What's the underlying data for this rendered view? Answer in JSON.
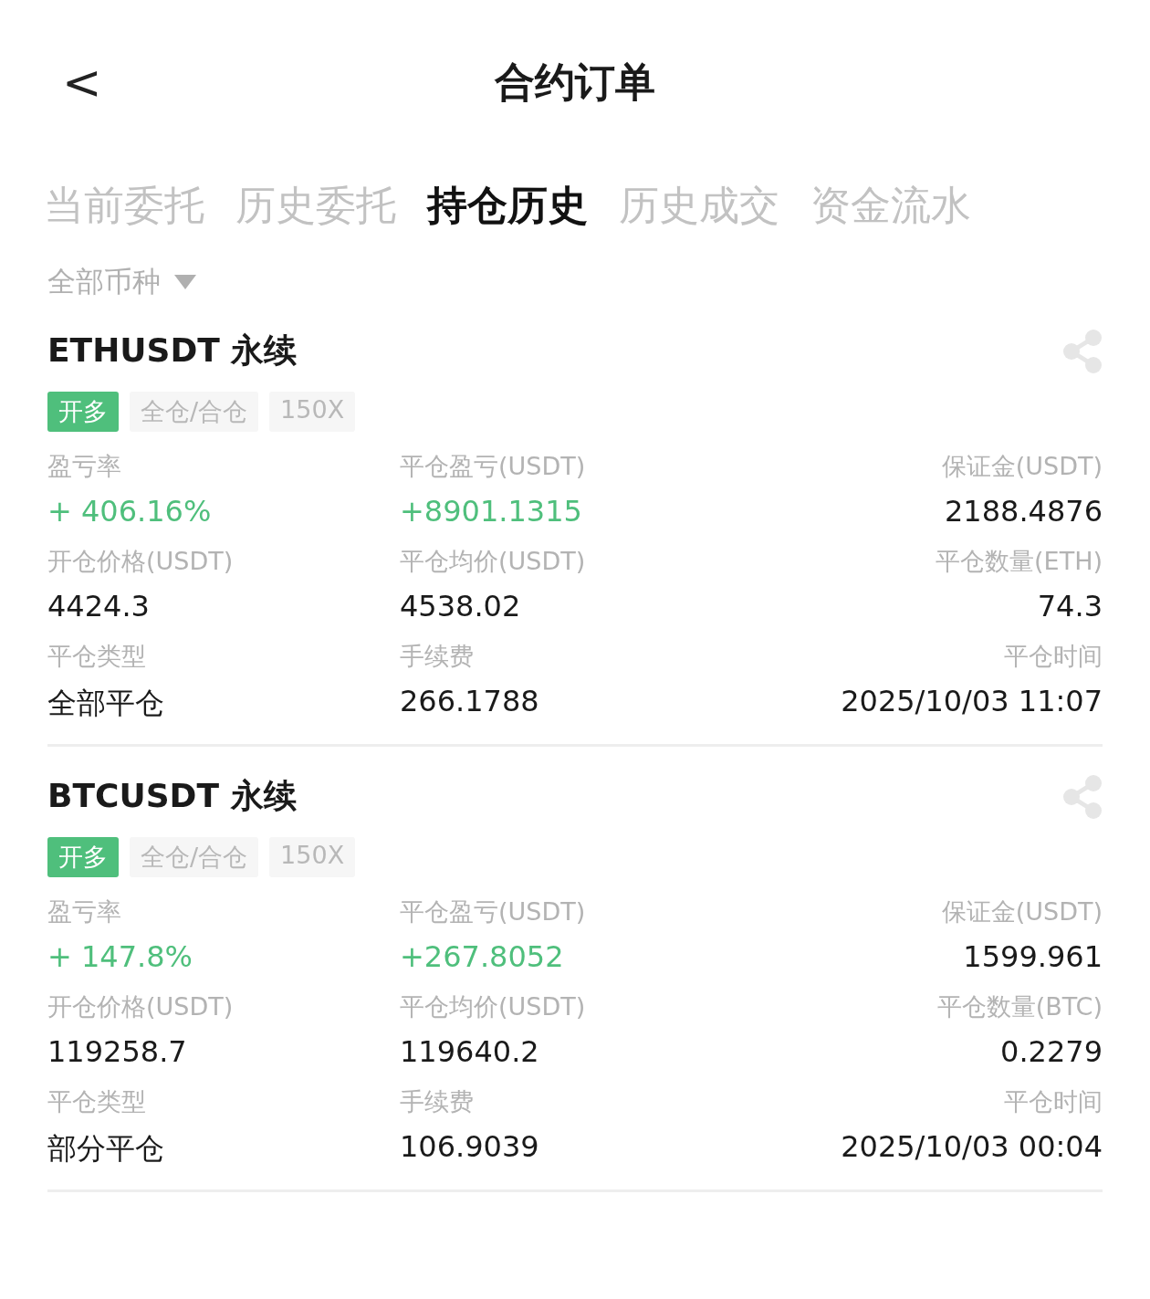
{
  "header": {
    "back": "<",
    "title": "合约订单"
  },
  "tabs": [
    {
      "label": "当前委托",
      "selected": false
    },
    {
      "label": "历史委托",
      "selected": false
    },
    {
      "label": "持仓历史",
      "selected": true
    },
    {
      "label": "历史成交",
      "selected": false
    },
    {
      "label": "资金流水",
      "selected": false
    }
  ],
  "filter": {
    "label": "全部币种"
  },
  "positions": [
    {
      "symbol": "ETHUSDT 永续",
      "tags": [
        {
          "label": "开多",
          "kind": "side"
        },
        {
          "label": "全仓/合仓",
          "kind": "plain"
        },
        {
          "label": "150X",
          "kind": "plain"
        }
      ],
      "fields": [
        {
          "label": "盈亏率",
          "value": "+ 406.16%",
          "gain": true
        },
        {
          "label": "平仓盈亏(USDT)",
          "value": "+8901.1315",
          "gain": true
        },
        {
          "label": "保证金(USDT)",
          "value": "2188.4876",
          "gain": false
        },
        {
          "label": "开仓价格(USDT)",
          "value": "4424.3",
          "gain": false
        },
        {
          "label": "平仓均价(USDT)",
          "value": "4538.02",
          "gain": false
        },
        {
          "label": "平仓数量(ETH)",
          "value": "74.3",
          "gain": false
        },
        {
          "label": "平仓类型",
          "value": "全部平仓",
          "gain": false
        },
        {
          "label": "手续费",
          "value": "266.1788",
          "gain": false
        },
        {
          "label": "平仓时间",
          "value": "2025/10/03 11:07",
          "gain": false
        }
      ]
    },
    {
      "symbol": "BTCUSDT 永续",
      "tags": [
        {
          "label": "开多",
          "kind": "side"
        },
        {
          "label": "全仓/合仓",
          "kind": "plain"
        },
        {
          "label": "150X",
          "kind": "plain"
        }
      ],
      "fields": [
        {
          "label": "盈亏率",
          "value": "+ 147.8%",
          "gain": true
        },
        {
          "label": "平仓盈亏(USDT)",
          "value": "+267.8052",
          "gain": true
        },
        {
          "label": "保证金(USDT)",
          "value": "1599.961",
          "gain": false
        },
        {
          "label": "开仓价格(USDT)",
          "value": "119258.7",
          "gain": false
        },
        {
          "label": "平仓均价(USDT)",
          "value": "119640.2",
          "gain": false
        },
        {
          "label": "平仓数量(BTC)",
          "value": "0.2279",
          "gain": false
        },
        {
          "label": "平仓类型",
          "value": "部分平仓",
          "gain": false
        },
        {
          "label": "手续费",
          "value": "106.9039",
          "gain": false
        },
        {
          "label": "平仓时间",
          "value": "2025/10/03 00:04",
          "gain": false
        }
      ]
    }
  ]
}
